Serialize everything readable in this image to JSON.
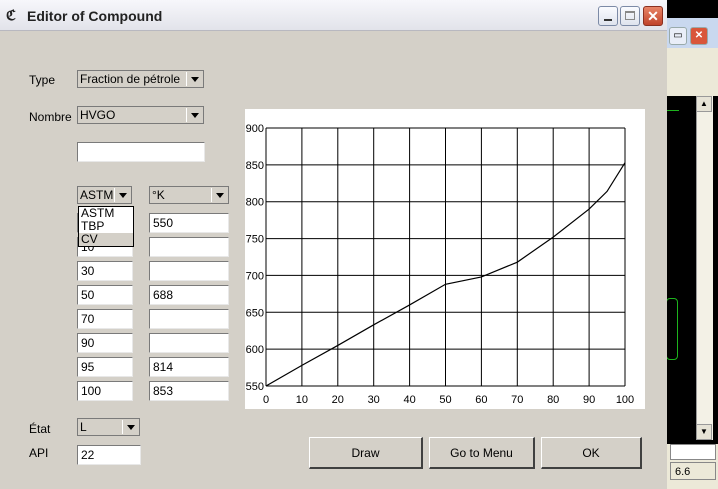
{
  "window": {
    "title": "Editor of Compound"
  },
  "form": {
    "type_label": "Type",
    "type_value": "Fraction de pétrole",
    "name_label": "Nombre",
    "name_value": "HVGO",
    "extra_field": "",
    "method_value": "ASTM",
    "method_options": [
      "ASTM",
      "TBP",
      "CV"
    ],
    "unit_value": "°K",
    "percents": [
      "",
      "10",
      "30",
      "50",
      "70",
      "90",
      "95",
      "100"
    ],
    "temperatures": [
      "550",
      "",
      "",
      "688",
      "",
      "",
      "814",
      "853"
    ],
    "state_label": "État",
    "state_value": "L",
    "api_label": "API",
    "api_value": "22"
  },
  "buttons": {
    "draw": "Draw",
    "menu": "Go to Menu",
    "ok": "OK"
  },
  "background_app": {
    "status": "6.6"
  },
  "chart_data": {
    "type": "line",
    "x": [
      0,
      10,
      20,
      30,
      40,
      50,
      60,
      70,
      80,
      90,
      95,
      100
    ],
    "series": [
      {
        "values": [
          550,
          578,
          605,
          633,
          660,
          688,
          698,
          718,
          752,
          790,
          814,
          853
        ]
      }
    ],
    "xlim": [
      0,
      100
    ],
    "ylim": [
      550,
      900
    ],
    "xticks": [
      "0",
      "10",
      "20",
      "30",
      "40",
      "50",
      "60",
      "70",
      "80",
      "90",
      "100"
    ],
    "yticks": [
      "550",
      "600",
      "650",
      "700",
      "750",
      "800",
      "850",
      "900"
    ],
    "grid": true,
    "color": "#000000"
  }
}
